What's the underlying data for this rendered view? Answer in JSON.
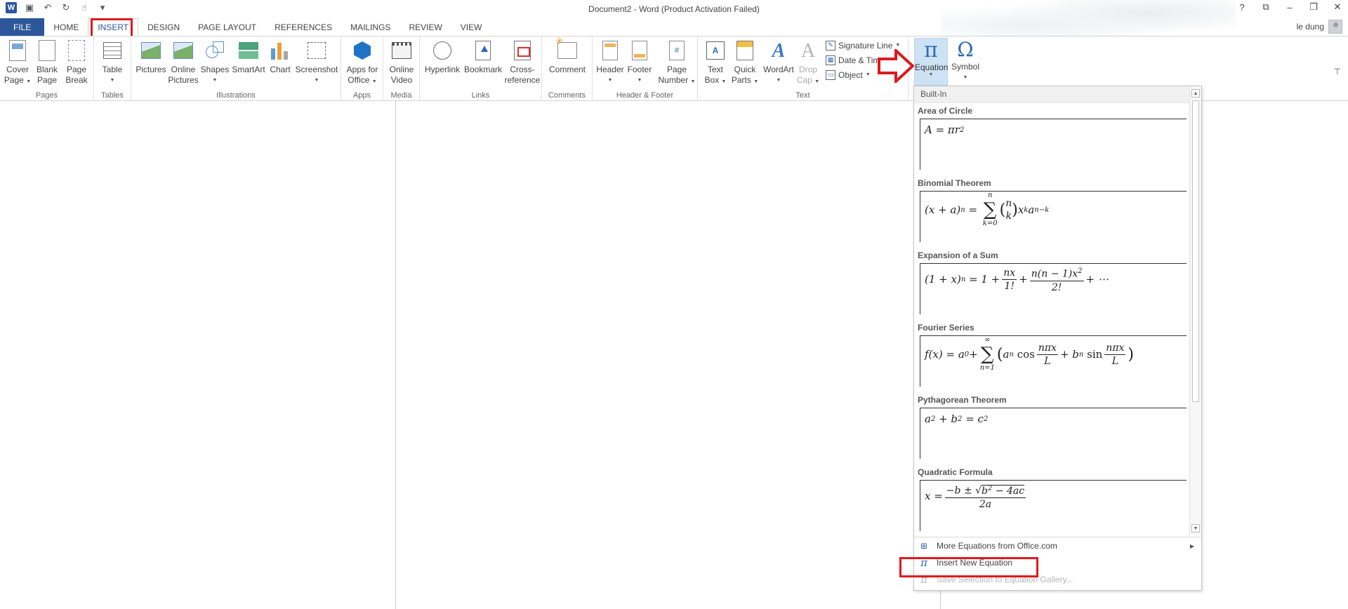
{
  "window": {
    "title": "Document2 - Word (Product Activation Failed)",
    "user": "le dung",
    "controls": [
      "?",
      "⧉",
      "–",
      "❐",
      "✕"
    ]
  },
  "qat": {
    "icons": [
      "word-logo-icon",
      "save-icon",
      "undo-icon",
      "redo-icon",
      "touch-mode-icon",
      "customize-qat-icon"
    ]
  },
  "tabs": [
    "FILE",
    "HOME",
    "INSERT",
    "DESIGN",
    "PAGE LAYOUT",
    "REFERENCES",
    "MAILINGS",
    "REVIEW",
    "VIEW"
  ],
  "active_tab": "INSERT",
  "ribbon": {
    "groups": {
      "pages": "Pages",
      "tables": "Tables",
      "illustrations": "Illustrations",
      "apps": "Apps",
      "media": "Media",
      "links": "Links",
      "comments": "Comments",
      "header_footer": "Header & Footer",
      "text": "Text"
    },
    "buttons": {
      "cover_page": [
        "Cover",
        "Page"
      ],
      "blank_page": [
        "Blank",
        "Page"
      ],
      "page_break": [
        "Page",
        "Break"
      ],
      "table": "Table",
      "pictures": "Pictures",
      "online_pictures": [
        "Online",
        "Pictures"
      ],
      "shapes": "Shapes",
      "smartart": "SmartArt",
      "chart": "Chart",
      "screenshot": "Screenshot",
      "apps_for_office": [
        "Apps for",
        "Office"
      ],
      "online_video": [
        "Online",
        "Video"
      ],
      "hyperlink": "Hyperlink",
      "bookmark": "Bookmark",
      "cross_reference": [
        "Cross-",
        "reference"
      ],
      "comment": "Comment",
      "header": "Header",
      "footer": "Footer",
      "page_number": [
        "Page",
        "Number"
      ],
      "text_box": [
        "Text",
        "Box"
      ],
      "quick_parts": [
        "Quick",
        "Parts"
      ],
      "wordart": "WordArt",
      "drop_cap": [
        "Drop",
        "Cap"
      ],
      "signature_line": "Signature Line",
      "date_time": "Date & Time",
      "object": "Object",
      "equation": "Equation",
      "symbol": "Symbol"
    }
  },
  "gallery": {
    "header": "Built-In",
    "equations": [
      {
        "title": "Area of Circle"
      },
      {
        "title": "Binomial Theorem"
      },
      {
        "title": "Expansion of a Sum"
      },
      {
        "title": "Fourier Series"
      },
      {
        "title": "Pythagorean Theorem"
      },
      {
        "title": "Quadratic Formula"
      }
    ],
    "footer": {
      "more": "More Equations from Office.com",
      "insert_new": "Insert New Equation",
      "save_selection": "Save Selection to Equation Gallery..."
    }
  },
  "colors": {
    "accent": "#2b579a",
    "highlight": "#e0191f",
    "selected_button": "#cde2f5"
  }
}
